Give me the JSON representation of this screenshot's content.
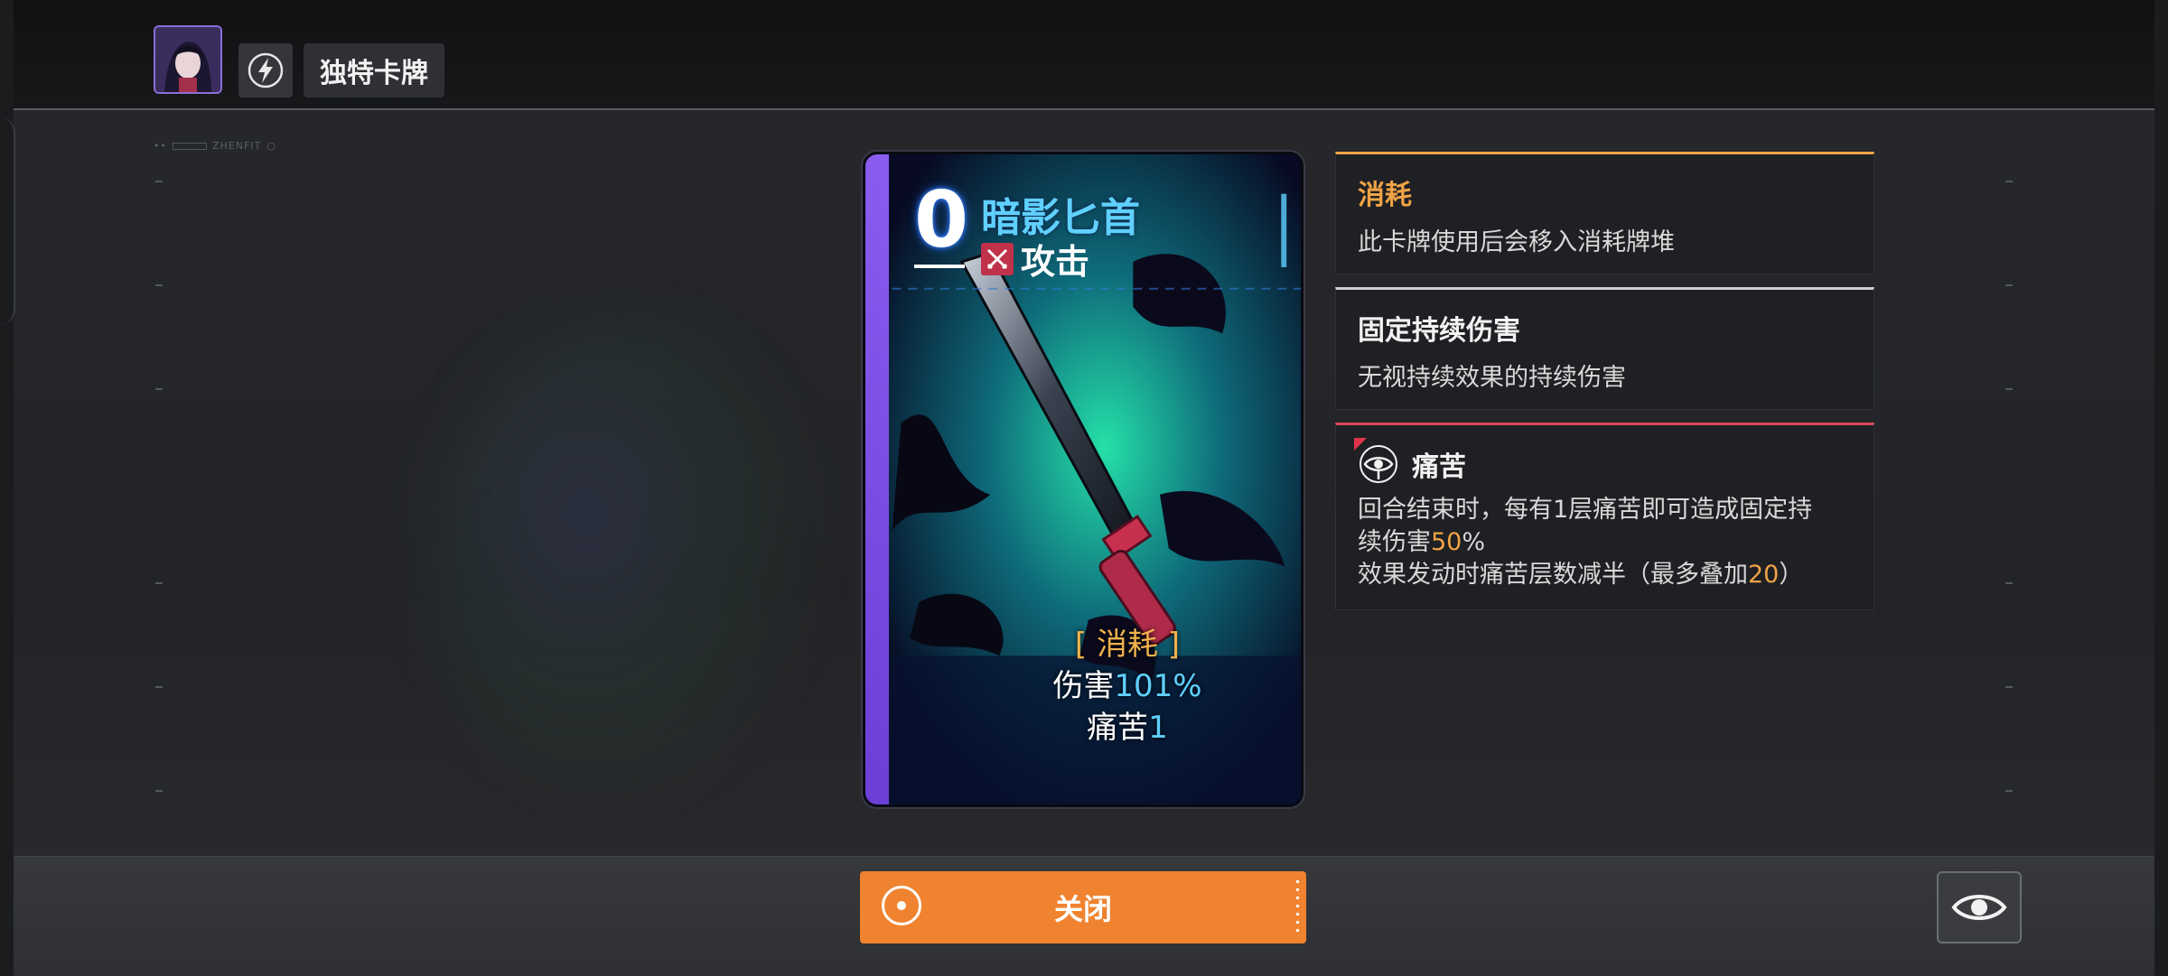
{
  "header": {
    "title": "独特卡牌"
  },
  "hud": {
    "label": "ZHENFIT"
  },
  "card": {
    "cost": "0",
    "name": "暗影匕首",
    "type": "攻击",
    "stats": {
      "tag": "[ 消耗 ]",
      "damage_label": "伤害",
      "damage_value": "101%",
      "pain_label": "痛苦",
      "pain_value": "1"
    }
  },
  "keywords": [
    {
      "title": "消耗",
      "desc": "此卡牌使用后会移入消耗牌堆",
      "accent": "#f0a346"
    },
    {
      "title": "固定持续伤害",
      "desc": "无视持续效果的持续伤害",
      "accent": "#cfcfcf"
    },
    {
      "title": "痛苦",
      "desc_line1_a": "回合结束时，每有1层痛苦即可造成固定持",
      "desc_line2_a": "续伤害",
      "desc_line2_hl": "50",
      "desc_line2_b": "%",
      "desc_line3_a": "效果发动时痛苦层数减半（最多叠加",
      "desc_line3_hl": "20",
      "desc_line3_b": "）",
      "accent": "#d94a5a"
    }
  ],
  "footer": {
    "close_label": "关闭"
  },
  "colors": {
    "accent_orange": "#f0832f",
    "card_name_blue": "#5fd0ff"
  }
}
